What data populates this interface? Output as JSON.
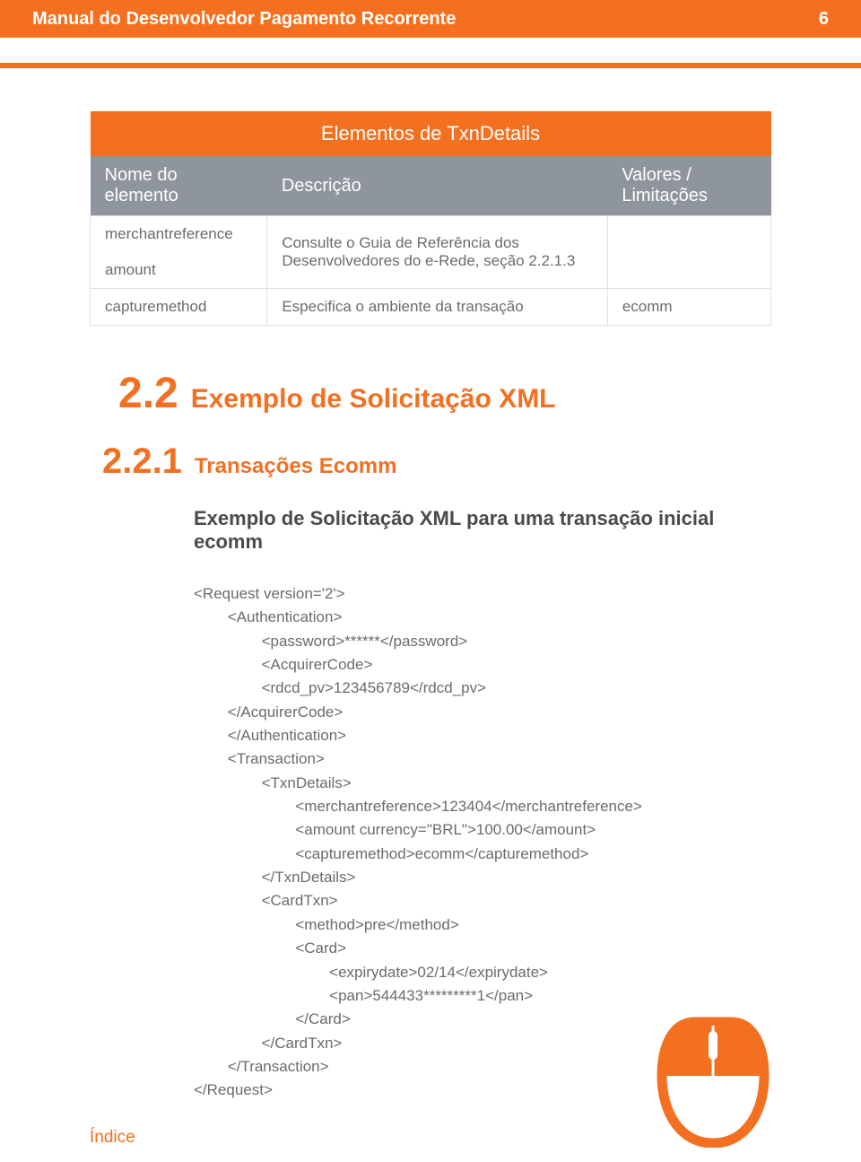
{
  "header": {
    "title": "Manual do Desenvolvedor Pagamento Recorrente",
    "page_number": "6"
  },
  "table": {
    "title": "Elementos de TxnDetails",
    "headers": {
      "col1": "Nome do elemento",
      "col2": "Descrição",
      "col3": "Valores / Limitações"
    },
    "rows": [
      {
        "c1": "merchantreference",
        "c2": "Consulte o Guia de Referência dos Desenvolvedores do e-Rede, seção 2.2.1.3",
        "c3": ""
      },
      {
        "c1": "amount",
        "c2": "",
        "c3": ""
      },
      {
        "c1": "capturemethod",
        "c2": "Especifica o ambiente da transação",
        "c3": "ecomm"
      }
    ]
  },
  "section": {
    "number": "2.2",
    "title": "Exemplo de Solicitação XML"
  },
  "subsection": {
    "number": "2.2.1",
    "title": "Transações Ecomm",
    "caption": "Exemplo de Solicitação XML para uma transação inicial ecomm"
  },
  "xml": "<Request version='2'>\n        <Authentication>\n                <password>******</password>\n                <AcquirerCode>\n                <rdcd_pv>123456789</rdcd_pv>\n        </AcquirerCode>\n        </Authentication>\n        <Transaction>\n                <TxnDetails>\n                        <merchantreference>123404</merchantreference>\n                        <amount currency=\"BRL\">100.00</amount>\n                        <capturemethod>ecomm</capturemethod>\n                </TxnDetails>\n                <CardTxn>\n                        <method>pre</method>\n                        <Card>\n                                <expirydate>02/14</expirydate>\n                                <pan>544433*********1</pan>\n                        </Card>\n                </CardTxn>\n        </Transaction>\n</Request>",
  "footer": {
    "index_label": "Índice"
  }
}
